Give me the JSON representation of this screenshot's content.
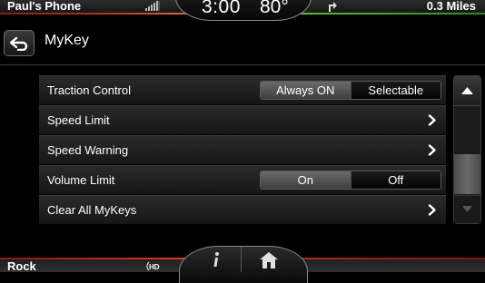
{
  "status_bar": {
    "phone_name": "Paul's Phone",
    "signal_icon": "signal-bars-icon",
    "time": "3:00",
    "temperature": "80°",
    "nav_icon": "turn-right-arrow-icon",
    "distance": "0.3 Miles"
  },
  "header": {
    "back_icon": "back-arrow-icon",
    "title": "MyKey"
  },
  "settings": [
    {
      "label": "Traction Control",
      "type": "toggle",
      "options": [
        "Always ON",
        "Selectable"
      ],
      "selected": "Always ON"
    },
    {
      "label": "Speed Limit",
      "type": "submenu",
      "icon": "chevron-right-icon"
    },
    {
      "label": "Speed Warning",
      "type": "submenu",
      "icon": "chevron-right-icon"
    },
    {
      "label": "Volume Limit",
      "type": "toggle",
      "options": [
        "On",
        "Off"
      ],
      "selected": "On"
    },
    {
      "label": "Clear All MyKeys",
      "type": "submenu",
      "icon": "chevron-right-icon"
    }
  ],
  "scrollbar": {
    "up_icon": "scroll-up-icon",
    "down_icon": "scroll-down-icon"
  },
  "bottom_bar": {
    "source": "Rock",
    "hd_icon": "hd-radio-icon",
    "info_icon": "info-icon",
    "home_icon": "home-icon"
  },
  "colors": {
    "accent_red": "#c03a22",
    "accent_green": "#5fbf3a",
    "selected_segment": "#5a5a5a"
  }
}
